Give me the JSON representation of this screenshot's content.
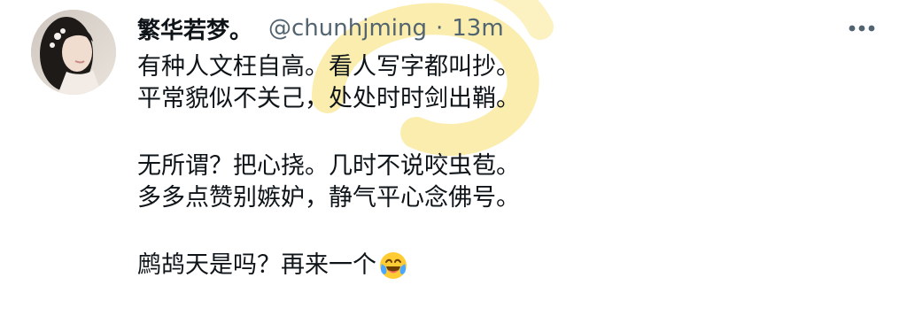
{
  "tweet": {
    "display_name": "繁华若梦。",
    "handle": "@chunhjming",
    "separator": "·",
    "timestamp": "13m",
    "more_icon": "more-horizontal-icon",
    "avatar_icon": "avatar",
    "lines": [
      "有种人文枉自高。看人写字都叫抄。",
      "平常貌似不关己，处处时时剑出鞘。",
      "",
      "无所谓？把心挠。几时不说咬虫苞。",
      "多多点赞别嫉妒，静气平心念佛号。",
      "",
      "鹧鸪天是吗？再来一个"
    ],
    "emoji": "face-with-tears-of-joy",
    "colors": {
      "text": "#0f1419",
      "secondary": "#536471",
      "watermark": "#f5d84a"
    }
  }
}
